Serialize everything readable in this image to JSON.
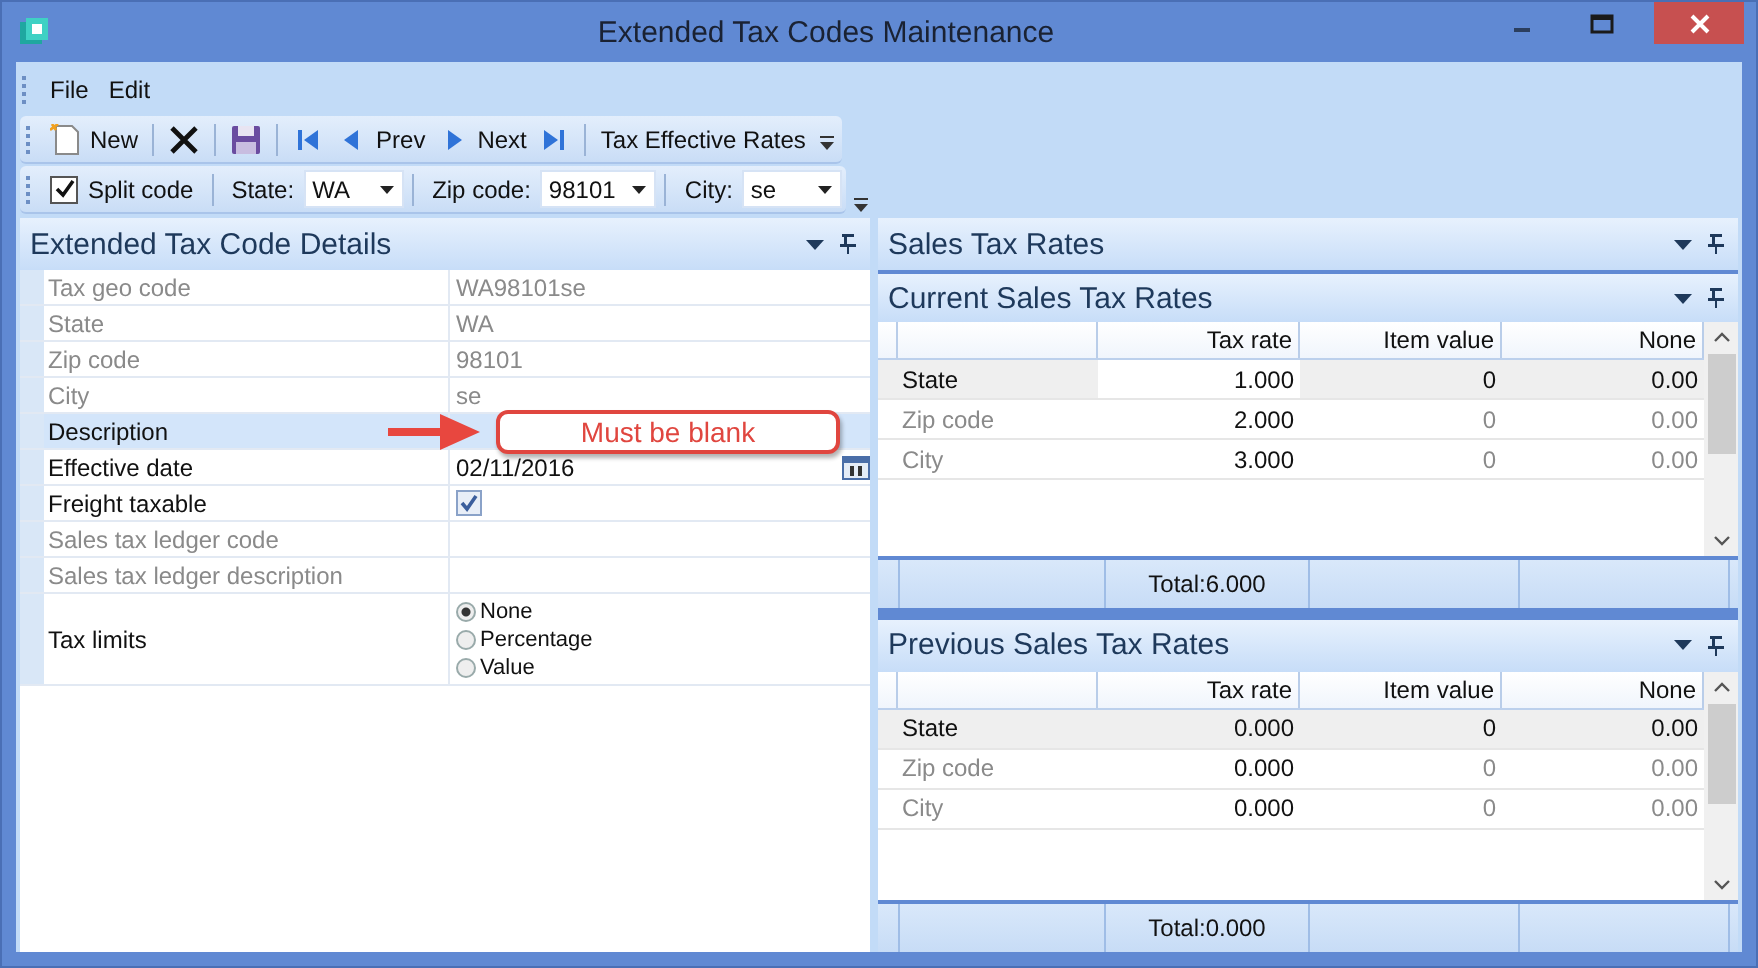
{
  "window": {
    "title": "Extended Tax Codes Maintenance"
  },
  "menu": [
    "File",
    "Edit"
  ],
  "toolbar": [
    {
      "kind": "new",
      "label": "New"
    },
    {
      "kind": "separator"
    },
    {
      "kind": "delete"
    },
    {
      "kind": "separator"
    },
    {
      "kind": "save"
    },
    {
      "kind": "separator"
    },
    {
      "kind": "first"
    },
    {
      "kind": "prev",
      "label": "Prev"
    },
    {
      "kind": "next",
      "label": "Next"
    },
    {
      "kind": "last"
    },
    {
      "kind": "separator"
    },
    {
      "kind": "text",
      "label": "Tax Effective Rates"
    }
  ],
  "filter_bar": [
    {
      "kind": "checkbox",
      "label": "Split code",
      "checked": true
    },
    {
      "kind": "combo",
      "label": "State:",
      "value": "WA"
    },
    {
      "kind": "combo",
      "label": "Zip code:",
      "value": "98101"
    },
    {
      "kind": "combo",
      "label": "City:",
      "value": "se"
    }
  ],
  "details": {
    "title": "Extended Tax Code Details",
    "rows": [
      {
        "label": "Tax geo code",
        "kind": "text",
        "value": "WA98101se",
        "readonly": true,
        "selected": false
      },
      {
        "label": "State",
        "kind": "text",
        "value": "WA",
        "readonly": true,
        "selected": false
      },
      {
        "label": "Zip code",
        "kind": "text",
        "value": "98101",
        "readonly": true,
        "selected": false
      },
      {
        "label": "City",
        "kind": "text",
        "value": "se",
        "readonly": true,
        "selected": false
      },
      {
        "label": "Description",
        "kind": "text",
        "readonly": false,
        "selected": true
      },
      {
        "label": "Effective date",
        "kind": "date",
        "value": "02/11/2016",
        "readonly": false,
        "selected": false
      },
      {
        "label": "Freight taxable",
        "kind": "checkbox",
        "checked": true,
        "readonly": false,
        "selected": false
      },
      {
        "label": "Sales tax ledger code",
        "kind": "text",
        "readonly": true,
        "selected": false
      },
      {
        "label": "Sales tax ledger description",
        "kind": "text",
        "readonly": true,
        "selected": false
      },
      {
        "label": "Tax limits",
        "kind": "radio",
        "readonly": false,
        "selected": false,
        "options": [
          {
            "label": "None",
            "selected": true
          },
          {
            "label": "Percentage",
            "selected": false
          },
          {
            "label": "Value",
            "selected": false
          }
        ]
      }
    ]
  },
  "annotation": {
    "text": "Must be blank"
  },
  "sales_tax_rates": {
    "title": "Sales Tax Rates",
    "panels": [
      {
        "title": "Current Sales Tax Rates",
        "columns": [
          {
            "label": "Tax rate",
            "editable": true
          },
          {
            "label": "Item value",
            "editable": false
          },
          {
            "label": "None",
            "editable": false
          }
        ],
        "rows": [
          {
            "name": "State",
            "cells": [
              "1.000",
              "0",
              "0.00"
            ],
            "selected": true
          },
          {
            "name": "Zip code",
            "cells": [
              "2.000",
              "0",
              "0.00"
            ],
            "selected": false
          },
          {
            "name": "City",
            "cells": [
              "3.000",
              "0",
              "0.00"
            ],
            "selected": false
          }
        ],
        "total": "Total:6.000"
      },
      {
        "title": "Previous Sales Tax Rates",
        "columns": [
          {
            "label": "Tax rate",
            "editable": true
          },
          {
            "label": "Item value",
            "editable": false
          },
          {
            "label": "None",
            "editable": false
          }
        ],
        "rows": [
          {
            "name": "State",
            "cells": [
              "0.000",
              "0",
              "0.00"
            ],
            "selected": true
          },
          {
            "name": "Zip code",
            "cells": [
              "0.000",
              "0",
              "0.00"
            ],
            "selected": false
          },
          {
            "name": "City",
            "cells": [
              "0.000",
              "0",
              "0.00"
            ],
            "selected": false
          }
        ],
        "total": "Total:0.000"
      }
    ]
  }
}
